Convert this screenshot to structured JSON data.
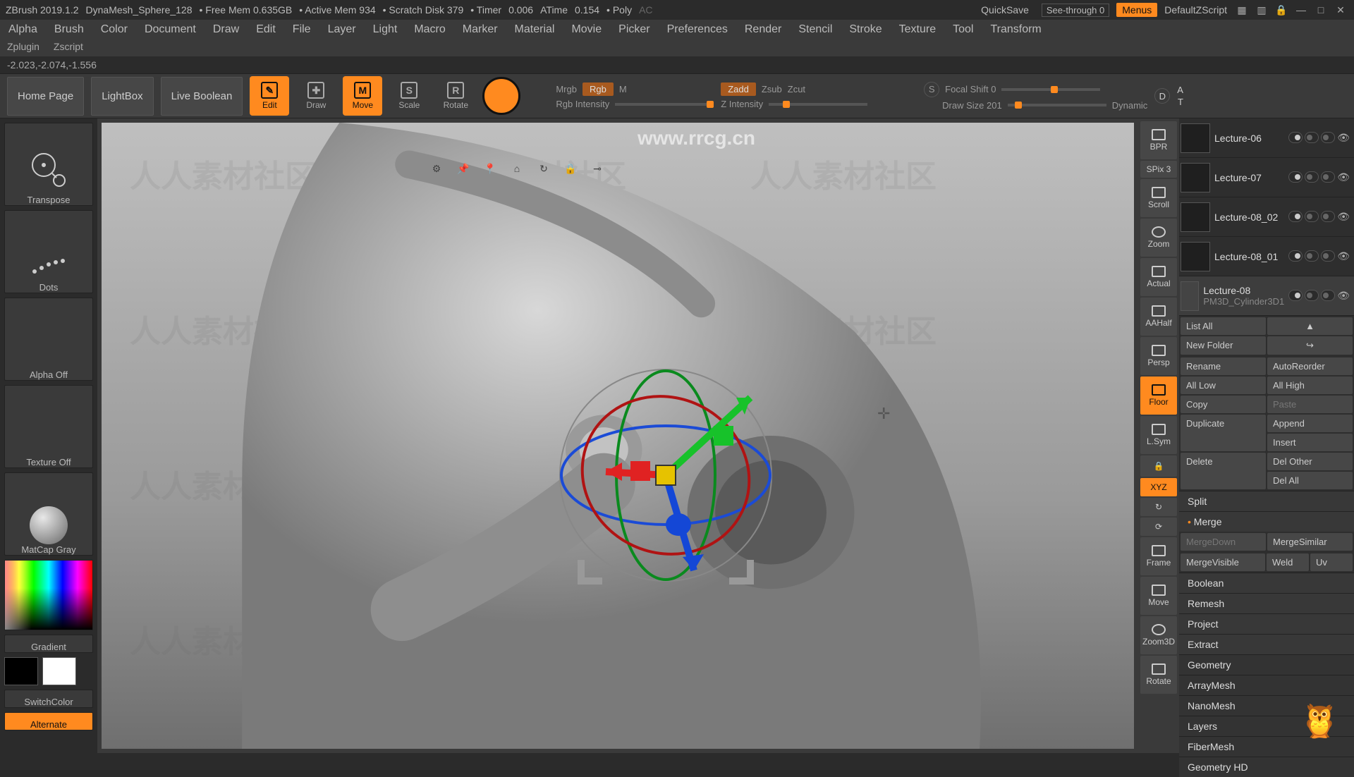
{
  "titlebar": {
    "app": "ZBrush 2019.1.2",
    "project": "DynaMesh_Sphere_128",
    "freemem": "• Free Mem 0.635GB",
    "activemem": "• Active Mem 934",
    "scratch": "• Scratch Disk 379",
    "timer": "• Timer",
    "timer_val": "0.006",
    "atime": "ATime",
    "atime_val": "0.154",
    "poly": "• Poly",
    "ac": "AC",
    "quicksave": "QuickSave",
    "seethrough": "See-through  0",
    "menus": "Menus",
    "zscript": "DefaultZScript"
  },
  "menu": {
    "items": [
      "Alpha",
      "Brush",
      "Color",
      "Document",
      "Draw",
      "Edit",
      "File",
      "Layer",
      "Light",
      "Macro",
      "Marker",
      "Material",
      "Movie",
      "Picker",
      "Preferences",
      "Render",
      "Stencil",
      "Stroke",
      "Texture",
      "Tool",
      "Transform"
    ],
    "items2": [
      "Zplugin",
      "Zscript"
    ]
  },
  "coords": "-2.023,-2.074,-1.556",
  "toolbar": {
    "homepage": "Home Page",
    "lightbox": "LightBox",
    "liveboolean": "Live Boolean",
    "edit": "Edit",
    "draw": "Draw",
    "move": "Move",
    "scale": "Scale",
    "rotate": "Rotate",
    "mrgb": "Mrgb",
    "rgb": "Rgb",
    "m": "M",
    "rgb_intensity": "Rgb Intensity",
    "zadd": "Zadd",
    "zsub": "Zsub",
    "zcut": "Zcut",
    "z_intensity": "Z Intensity",
    "focal_shift": "Focal Shift  0",
    "draw_size": "Draw Size  201",
    "dynamic": "Dynamic",
    "a": "A",
    "t": "T",
    "s_icon": "S",
    "d_icon": "D"
  },
  "left": {
    "transpose": "Transpose",
    "dots": "Dots",
    "alpha_off": "Alpha Off",
    "texture_off": "Texture Off",
    "matcap": "MatCap Gray",
    "gradient": "Gradient",
    "switchcolor": "SwitchColor",
    "alternate": "Alternate"
  },
  "right": {
    "bpr": "BPR",
    "spix": "SPix 3",
    "scroll": "Scroll",
    "zoom": "Zoom",
    "actual": "Actual",
    "aahalf": "AAHalf",
    "persp": "Persp",
    "floor": "Floor",
    "lsym": "L.Sym",
    "xyz": "XYZ",
    "frame": "Frame",
    "move": "Move",
    "zoom3d": "Zoom3D",
    "rotate": "Rotate"
  },
  "subtools": [
    {
      "name": "Lecture-06"
    },
    {
      "name": "Lecture-07"
    },
    {
      "name": "Lecture-08_02"
    },
    {
      "name": "Lecture-08_01"
    },
    {
      "name": "Lecture-08",
      "selected": true,
      "sub": "PM3D_Cylinder3D1"
    }
  ],
  "panel": {
    "listall": "List All",
    "newfolder": "New Folder",
    "rename": "Rename",
    "autoreorder": "AutoReorder",
    "alllow": "All Low",
    "allhigh": "All High",
    "copy": "Copy",
    "paste": "Paste",
    "duplicate": "Duplicate",
    "append": "Append",
    "insert": "Insert",
    "delete": "Delete",
    "delother": "Del Other",
    "delall": "Del All",
    "split": "Split",
    "merge": "Merge",
    "mergedown": "MergeDown",
    "mergesimilar": "MergeSimilar",
    "mergevisible": "MergeVisible",
    "weld": "Weld",
    "uv": "Uv",
    "boolean": "Boolean",
    "remesh": "Remesh",
    "project": "Project",
    "extract": "Extract",
    "geometry": "Geometry",
    "arraymesh": "ArrayMesh",
    "nanomesh": "NanoMesh",
    "layers": "Layers",
    "fibermesh": "FiberMesh",
    "geometryhd": "Geometry HD"
  },
  "watermark_main": "人人素材社区",
  "watermark_url": "www.rrcg.cn"
}
